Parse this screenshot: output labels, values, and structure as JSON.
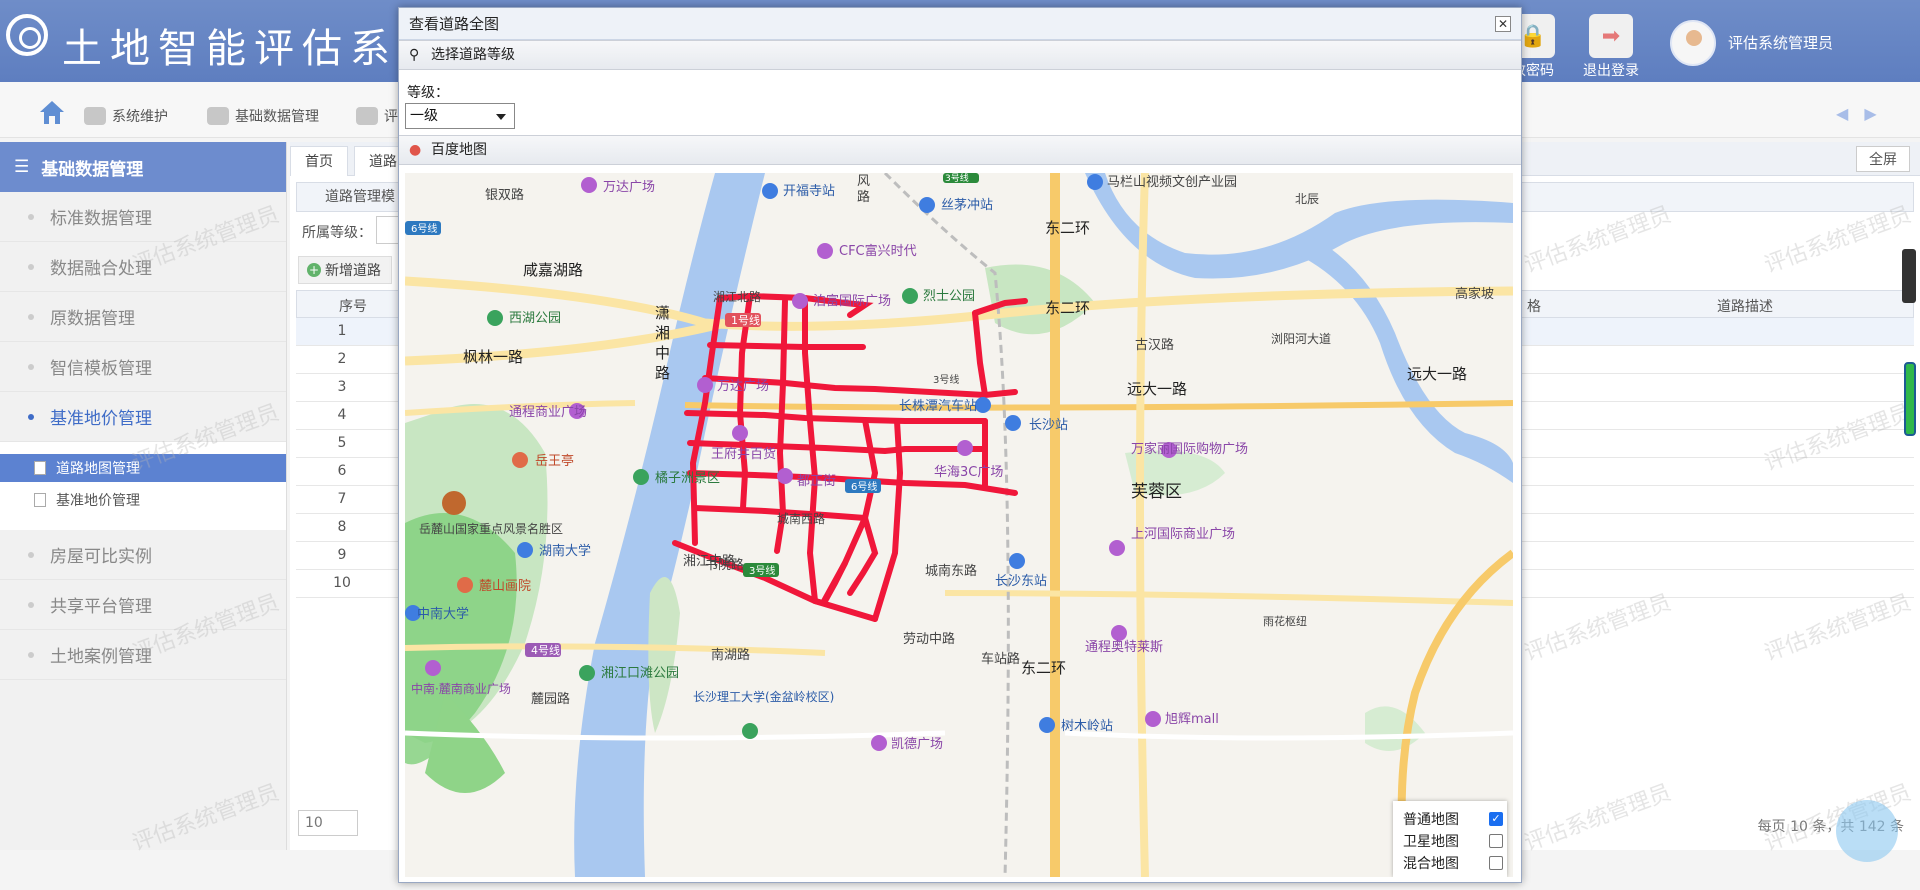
{
  "header": {
    "title": "土地智能评估系",
    "buttons": [
      {
        "label": "改密码",
        "icon": "lock-icon"
      },
      {
        "label": "退出登录",
        "icon": "logout-icon"
      }
    ],
    "user_name": "评估系统管理员"
  },
  "nav": {
    "items": [
      {
        "label": "系统维护",
        "icon": "users-icon"
      },
      {
        "label": "基础数据管理",
        "icon": "gear-icon"
      },
      {
        "label": "评",
        "icon": "money-bag-icon"
      }
    ]
  },
  "sidebar": {
    "header": "基础数据管理",
    "items": [
      "标准数据管理",
      "数据融合处理",
      "原数据管理",
      "智信模板管理",
      "基准地价管理"
    ],
    "subitems": [
      "道路地图管理",
      "基准地价管理"
    ],
    "items_after": [
      "房屋可比实例",
      "共享平台管理",
      "土地案例管理"
    ]
  },
  "main": {
    "tabs": [
      "首页",
      "道路"
    ],
    "fullscreen": "全屏",
    "panel_title": "道路管理模",
    "filter_label": "所属等级：",
    "add_button": "新增道路",
    "col_index": "序号",
    "col_width": "格",
    "col_desc": "道路描述",
    "rows": [
      "1",
      "2",
      "3",
      "4",
      "5",
      "6",
      "7",
      "8",
      "9",
      "10"
    ],
    "page_size": "10",
    "pager_info": "每页 10 条，共 142 条"
  },
  "watermark": "评估系统管理员",
  "dialog": {
    "title": "查看道路全图",
    "section_level": "选择道路等级",
    "level_label": "等级：",
    "level_value": "一级",
    "section_map": "百度地图",
    "layers": [
      {
        "label": "普通地图",
        "checked": true
      },
      {
        "label": "卫星地图",
        "checked": false
      },
      {
        "label": "混合地图",
        "checked": false
      }
    ]
  },
  "map_labels": {
    "places": [
      "银双路",
      "万达广场",
      "开福寺站",
      "风",
      "路",
      "丝茅冲站",
      "马栏山视频文创产业园",
      "CFC富兴时代",
      "烈士公园",
      "泊富国际广场",
      "咸嘉湖路",
      "西湖公园",
      "潇",
      "湘",
      "中",
      "路",
      "1号线",
      "枫林一路",
      "万达广场",
      "通程商业广场",
      "长株潭汽车站",
      "长沙站",
      "王府井百货",
      "远大一路",
      "远大一路",
      "高家坡",
      "古汉路",
      "浏阳河大道",
      "万家丽国际购物广场",
      "华海3C广场",
      "都正街",
      "橘子洲景区",
      "岳王亭",
      "岳麓山国家重点风景名胜区",
      "湖南大学",
      "麓山画院",
      "芙蓉区",
      "上河国际商业广场",
      "城南东路",
      "长沙东站",
      "湘江中路",
      "书院路",
      "中南大学",
      "4号线",
      "湘江口滩公园",
      "南湖路",
      "劳动中路",
      "车站路",
      "通程奥特莱斯",
      "雨花枢纽",
      "中南·麓南商业广场",
      "麓园路",
      "长沙理工大学(金盆岭校区)",
      "凯德广场",
      "树木岭站",
      "旭辉mall",
      "东二环",
      "东二环",
      "东二环",
      "6号线",
      "6号线",
      "3号线",
      "3号线",
      "城南西路",
      "湘江北路",
      "北辰",
      "3号线"
    ]
  },
  "colors": {
    "accent": "#6d8cce",
    "road": "#f0173a",
    "river": "#a9c8f0"
  }
}
